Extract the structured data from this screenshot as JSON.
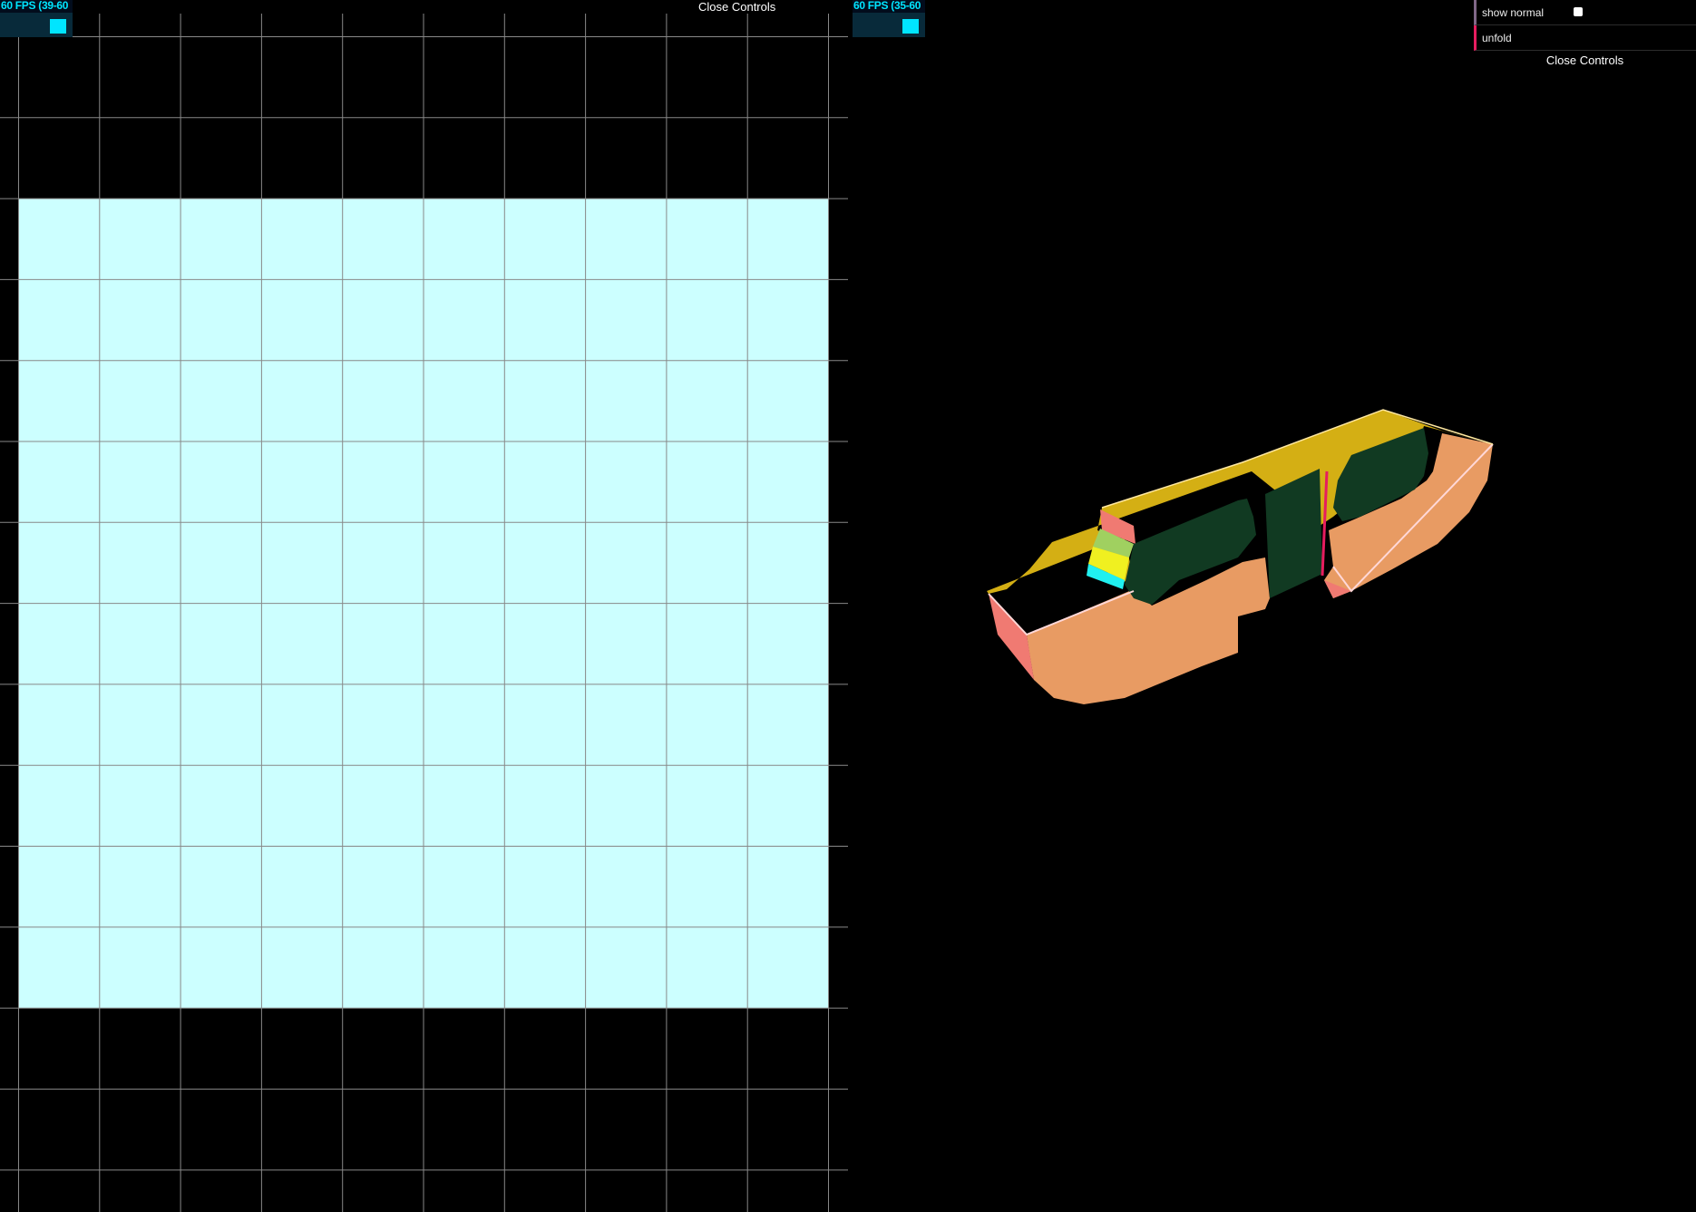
{
  "left_view": {
    "fps_label": "60 FPS (39-60",
    "close_controls": "Close Controls",
    "plane_color": "#ccffff",
    "grid_color": "#888888"
  },
  "right_view": {
    "fps_label": "60 FPS (35-60",
    "controls": {
      "show_normal_label": "show normal",
      "show_normal_checked": false,
      "unfold_label": "unfold",
      "close_controls": "Close Controls"
    },
    "model_colors": {
      "top": "#d4af14",
      "side": "#e89b63",
      "hole": "#113a22",
      "accent": "#f07a72"
    }
  }
}
